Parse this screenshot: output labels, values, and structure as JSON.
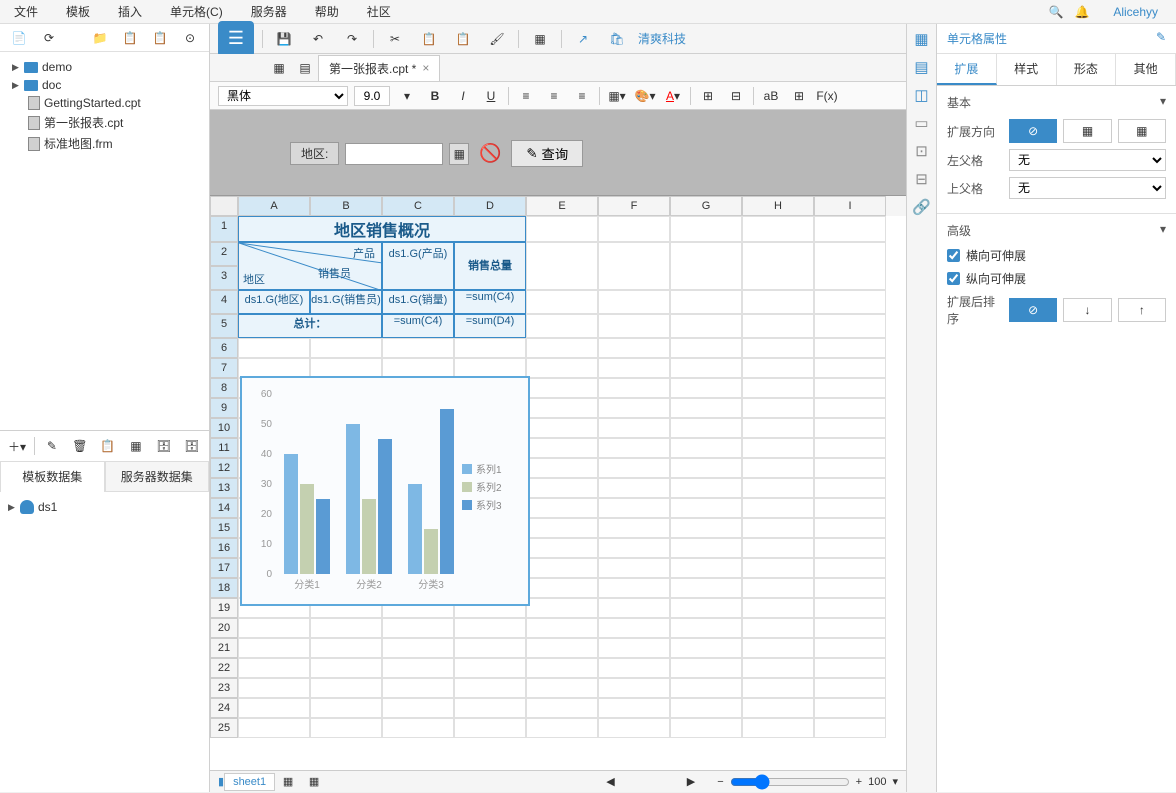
{
  "menus": [
    "文件",
    "模板",
    "插入",
    "单元格(C)",
    "服务器",
    "帮助",
    "社区"
  ],
  "username": "Alicehyy",
  "file_tree": {
    "folders": [
      "demo",
      "doc"
    ],
    "files": [
      "GettingStarted.cpt",
      "第一张报表.cpt",
      "标准地图.frm"
    ]
  },
  "dataset_tabs": [
    "模板数据集",
    "服务器数据集"
  ],
  "dataset_items": [
    "ds1"
  ],
  "toolbar": {
    "brand_link": "清爽科技"
  },
  "doc_tab": {
    "name": "第一张报表.cpt *"
  },
  "format": {
    "font": "黑体",
    "size": "9.0"
  },
  "param_bar": {
    "label": "地区:",
    "query_btn": "查询"
  },
  "columns": [
    "A",
    "B",
    "C",
    "D",
    "E",
    "F",
    "G",
    "H",
    "I"
  ],
  "report": {
    "title": "地区销售概况",
    "h_product": "产品",
    "h_salesman": "销售员",
    "h_region": "地区",
    "h_ds_prod": "ds1.G(产品)",
    "h_total": "销售总量",
    "r4_a": "ds1.G(地区)",
    "r4_b": "ds1.G(销售员)",
    "r4_c": "ds1.G(销量)",
    "r4_d": "=sum(C4)",
    "r5_a": "总计：",
    "r5_c": "=sum(C4)",
    "r5_d": "=sum(D4)"
  },
  "chart_data": {
    "type": "bar",
    "categories": [
      "分类1",
      "分类2",
      "分类3"
    ],
    "series": [
      {
        "name": "系列1",
        "values": [
          40,
          50,
          30
        ],
        "color": "#7eb8e4"
      },
      {
        "name": "系列2",
        "values": [
          30,
          25,
          15
        ],
        "color": "#c4d0b0"
      },
      {
        "name": "系列3",
        "values": [
          25,
          45,
          55
        ],
        "color": "#5a9bd4"
      }
    ],
    "ylim": [
      0,
      60
    ],
    "yticks": [
      0,
      10,
      20,
      30,
      40,
      50,
      60
    ]
  },
  "sheet_tab": "sheet1",
  "zoom": "100",
  "right_panel": {
    "title": "单元格属性",
    "tabs": [
      "扩展",
      "样式",
      "形态",
      "其他"
    ],
    "section_basic": "基本",
    "expand_dir_label": "扩展方向",
    "left_parent": "左父格",
    "top_parent": "上父格",
    "parent_value": "无",
    "section_adv": "高级",
    "check_h": "横向可伸展",
    "check_v": "纵向可伸展",
    "sort_label": "扩展后排序"
  }
}
